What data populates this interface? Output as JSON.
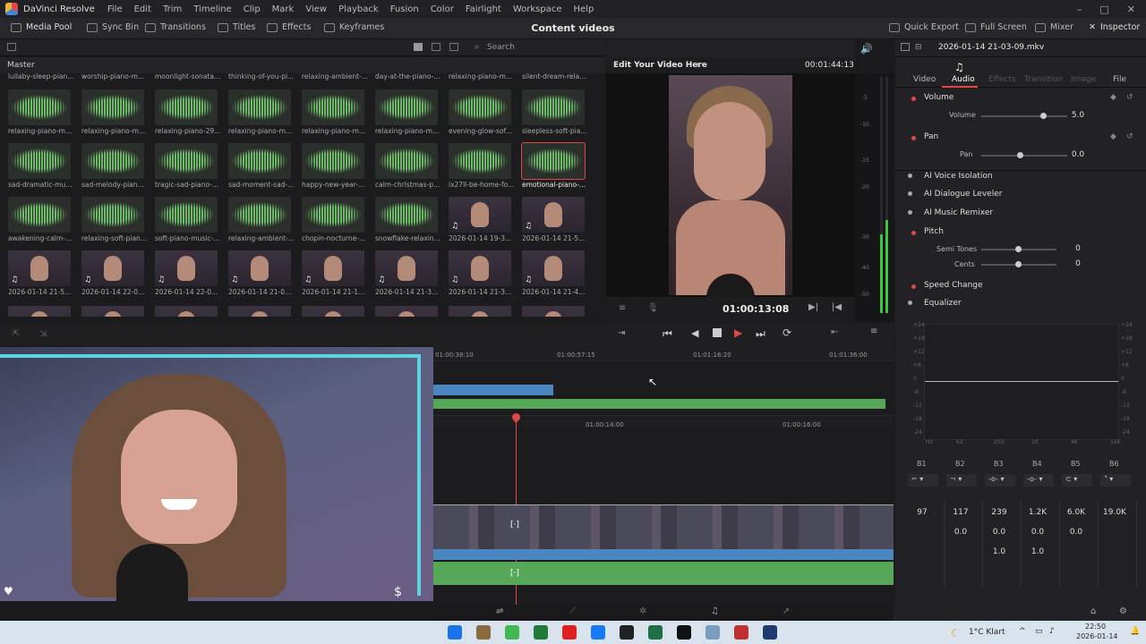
{
  "menubar": {
    "app_name": "DaVinci Resolve",
    "items": [
      "File",
      "Edit",
      "Trim",
      "Timeline",
      "Clip",
      "Mark",
      "View",
      "Playback",
      "Fusion",
      "Color",
      "Fairlight",
      "Workspace",
      "Help"
    ]
  },
  "toolbar": {
    "media_pool": "Media Pool",
    "sync_bin": "Sync Bin",
    "transitions": "Transitions",
    "titles": "Titles",
    "effects": "Effects",
    "keyframes": "Keyframes",
    "project_title": "Content videos",
    "quick_export": "Quick Export",
    "full_screen": "Full Screen",
    "mixer": "Mixer",
    "inspector": "Inspector"
  },
  "pool": {
    "search_placeholder": "Search",
    "bin": "Master",
    "top_partial": [
      "lullaby-sleep-pian...",
      "worship-piano-m...",
      "moonlight-sonata-...",
      "thinking-of-you-pi...",
      "relaxing-ambient-...",
      "day-at-the-piano-m...",
      "relaxing-piano-m...",
      "silent-dream-relax..."
    ],
    "rows": [
      [
        "relaxing-piano-mu...",
        "relaxing-piano-mu...",
        "relaxing-piano-29...",
        "relaxing-piano-mu...",
        "relaxing-piano-mu...",
        "relaxing-piano-mu...",
        "evening-glow-soft-...",
        "sleepless-soft-pia..."
      ],
      [
        "sad-dramatic-mus...",
        "sad-melody-piano...",
        "tragic-sad-piano-...",
        "sad-moment-sad-...",
        "happy-new-year-p...",
        "calm-christmas-pi...",
        "ix27ll-be-home-fo...",
        "emotional-piano-..."
      ],
      [
        "awakening-calm-p...",
        "relaxing-soft-pian...",
        "soft-piano-music-...",
        "relaxing-ambient-...",
        "chopin-nocturne-...",
        "snowflake-relaxin...",
        "2026-01-14 19-39-...",
        "2026-01-14 21-58-..."
      ],
      [
        "2026-01-14 21-53-...",
        "2026-01-14 22-01-...",
        "2026-01-14 22-05-...",
        "2026-01-14 21-05-...",
        "2026-01-14 21-10-...",
        "2026-01-14 21-36-...",
        "2026-01-14 21-39-...",
        "2026-01-14 21-45-..."
      ]
    ]
  },
  "viewer": {
    "title": "Edit Your Video Here",
    "duration": "00:01:44:13",
    "timecode": "01:00:13:08"
  },
  "meter": {
    "scale": [
      "-5",
      "-10",
      "-15",
      "-20",
      "-30",
      "-40",
      "-50"
    ]
  },
  "timeline": {
    "upper_ruler": [
      "01:00:38:10",
      "01:00:57:15",
      "01:01:16:20",
      "01:01:36:00"
    ],
    "lower_ruler": [
      "01:00:14:00",
      "01:00:16:00"
    ]
  },
  "inspector": {
    "clip_name": "2026-01-14 21-03-09.mkv",
    "tabs": [
      "Video",
      "Audio",
      "Effects",
      "Transition",
      "Image",
      "File"
    ],
    "volume_header": "Volume",
    "volume_label": "Volume",
    "volume_value": "5.0",
    "pan_header": "Pan",
    "pan_label": "Pan",
    "pan_value": "0.0",
    "voice_isolation": "AI Voice Isolation",
    "dialogue_leveler": "AI Dialogue Leveler",
    "music_remixer": "AI Music Remixer",
    "pitch": "Pitch",
    "semi_tones_label": "Semi Tones",
    "semi_tones_value": "0",
    "cents_label": "Cents",
    "cents_value": "0",
    "speed_change": "Speed Change",
    "equalizer": "Equalizer",
    "eq_y": [
      "+24",
      "+18",
      "+12",
      "+6",
      "0",
      "-6",
      "-12",
      "-18",
      "-24"
    ],
    "eq_x": [
      "Hz",
      "62",
      "250",
      "1K",
      "4K",
      "16K"
    ],
    "bands": [
      "B1",
      "B2",
      "B3",
      "B4",
      "B5",
      "B6"
    ],
    "freq": [
      "97",
      "117",
      "239",
      "1.2K",
      "6.0K",
      "19.0K"
    ],
    "gain": [
      "0.0",
      "0.0",
      "0.0",
      "0.0"
    ],
    "q": [
      "1.0",
      "1.0"
    ]
  },
  "taskbar": {
    "weather": "1°C  Klart",
    "time": "22:50",
    "date": "2026-01-14"
  }
}
